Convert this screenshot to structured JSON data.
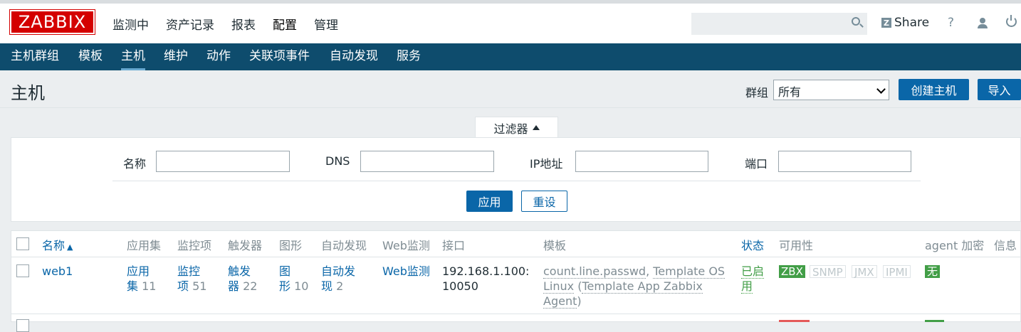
{
  "brand": "ZABBIX",
  "top_menu": [
    "监测中",
    "资产记录",
    "报表",
    "配置",
    "管理"
  ],
  "top_menu_selected": "配置",
  "search": {
    "value": "",
    "placeholder": ""
  },
  "header_right": {
    "share_label": "Share",
    "share_icon": "Z",
    "help_label": "?"
  },
  "sub_menu": [
    "主机群组",
    "模板",
    "主机",
    "维护",
    "动作",
    "关联项事件",
    "自动发现",
    "服务"
  ],
  "sub_menu_selected": "主机",
  "page": {
    "title": "主机",
    "group_label": "群组",
    "group_value": "所有",
    "create_button": "创建主机",
    "import_button": "导入"
  },
  "filter": {
    "tab_label": "过滤器",
    "fields": [
      {
        "label": "名称",
        "value": ""
      },
      {
        "label": "DNS",
        "value": ""
      },
      {
        "label": "IP地址",
        "value": ""
      },
      {
        "label": "端口",
        "value": ""
      }
    ],
    "apply_button": "应用",
    "reset_button": "重设"
  },
  "table": {
    "columns": [
      "名称",
      "应用集",
      "监控项",
      "触发器",
      "图形",
      "自动发现",
      "Web监测",
      "接口",
      "模板",
      "状态",
      "可用性",
      "agent 加密",
      "信息"
    ],
    "sort_arrow": "▲",
    "rows": [
      {
        "name": "web1",
        "applications": {
          "label_a": "应用",
          "label_b": "集",
          "count": "11"
        },
        "items": {
          "label_a": "监控",
          "label_b": "项",
          "count": "51"
        },
        "triggers": {
          "label_a": "触发",
          "label_b": "器",
          "count": "22"
        },
        "graphs": {
          "label_a": "图",
          "label_b": "形",
          "count": "10"
        },
        "discovery": {
          "label_a": "自动发",
          "label_b": "现",
          "count": "2"
        },
        "web": "Web监测",
        "interface_a": "192.168.1.100:",
        "interface_b": "10050",
        "template_1": "count.line.passwd",
        "template_2": "Template OS",
        "template_3": "Linux",
        "template_4": "Template App Zabbix",
        "template_5": "Agent",
        "status_a": "已启",
        "status_b": "用",
        "availability": [
          "ZBX",
          "SNMP",
          "JMX",
          "IPMI"
        ],
        "encryption": "无"
      }
    ]
  },
  "colors": {
    "brand_red": "#d40000",
    "nav_blue": "#0e4c6d",
    "link_blue": "#0a66a8",
    "status_green": "#429e47"
  }
}
